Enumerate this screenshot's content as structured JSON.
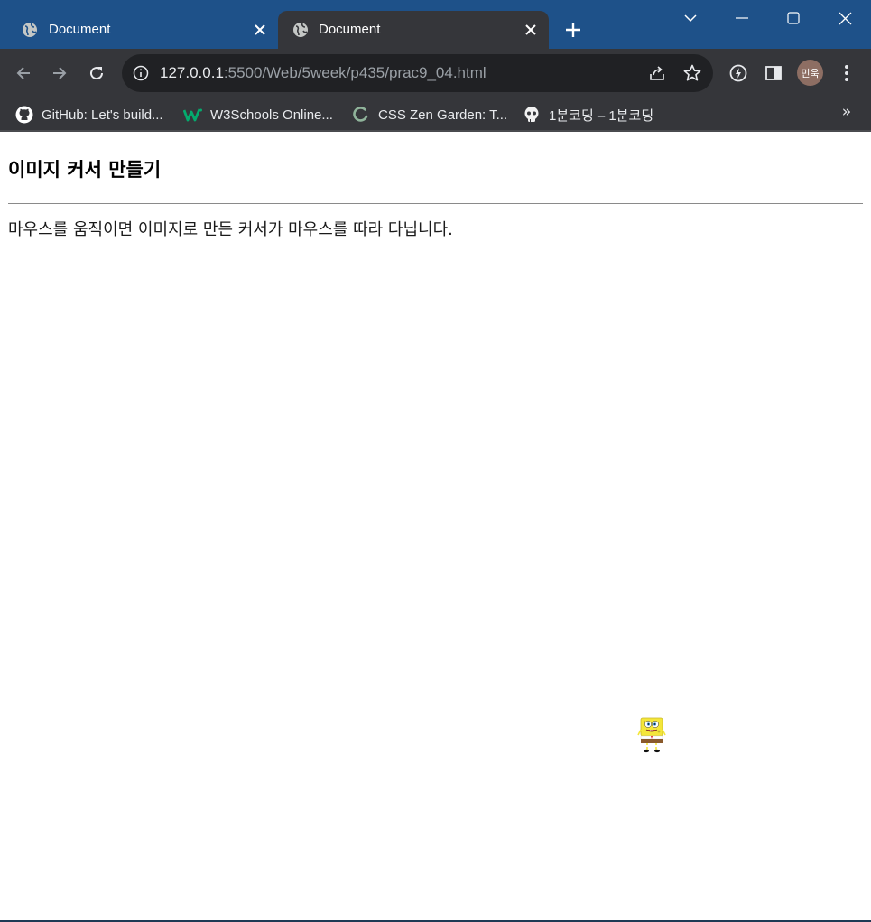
{
  "tabs": [
    {
      "title": "Document",
      "state": "inactive",
      "icon": "globe-icon"
    },
    {
      "title": "Document",
      "state": "active",
      "icon": "globe-icon"
    }
  ],
  "toolbar": {
    "url_host": "127.0.0.1",
    "url_path": ":5500/Web/5week/p435/prac9_04.html",
    "profile_initials": "민욱"
  },
  "bookmarks": [
    {
      "label": "GitHub: Let's build...",
      "icon": "github-icon"
    },
    {
      "label": "W3Schools Online...",
      "icon": "w3schools-icon"
    },
    {
      "label": "CSS Zen Garden: T...",
      "icon": "zen-garden-icon"
    },
    {
      "label": "1분코딩 – 1분코딩",
      "icon": "skull-icon"
    }
  ],
  "page": {
    "heading": "이미지 커서 만들기",
    "description": "마우스를 움직이면 이미지로 만든 커서가 마우스를 따라 다닙니다.",
    "cursor_image": "spongebob-cursor-image"
  },
  "colors": {
    "titlebar": "#1e5189",
    "toolbar": "#35363a",
    "omnibox": "#202124",
    "avatar": "#8d6e63"
  }
}
